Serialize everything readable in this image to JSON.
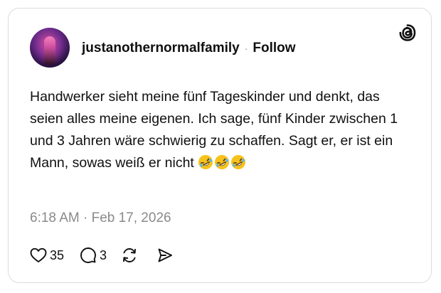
{
  "post": {
    "username": "justanothernormalfamily",
    "separator": "·",
    "follow_label": "Follow",
    "text": "Handwerker sieht meine fünf Tageskinder und denkt, das seien alles meine eigenen. Ich sage, fünf Kinder zwischen 1 und 3 Jahren wäre schwierig zu schaffen. Sagt er, er ist ein Mann, sowas weiß er nicht",
    "emojis": [
      "rolling-on-floor-laughing",
      "rolling-on-floor-laughing",
      "rolling-on-floor-laughing"
    ],
    "timestamp": "6:18 AM · Feb 17, 2026",
    "likes_count": "35",
    "replies_count": "3"
  },
  "icons": {
    "brand": "threads-logo-icon",
    "like": "heart-icon",
    "reply": "comment-bubble-icon",
    "repost": "repost-icon",
    "share": "send-icon"
  },
  "colors": {
    "text": "#101010",
    "muted": "#8a8a8a",
    "border": "#dcdcdc",
    "emoji": "#f7c21b"
  }
}
